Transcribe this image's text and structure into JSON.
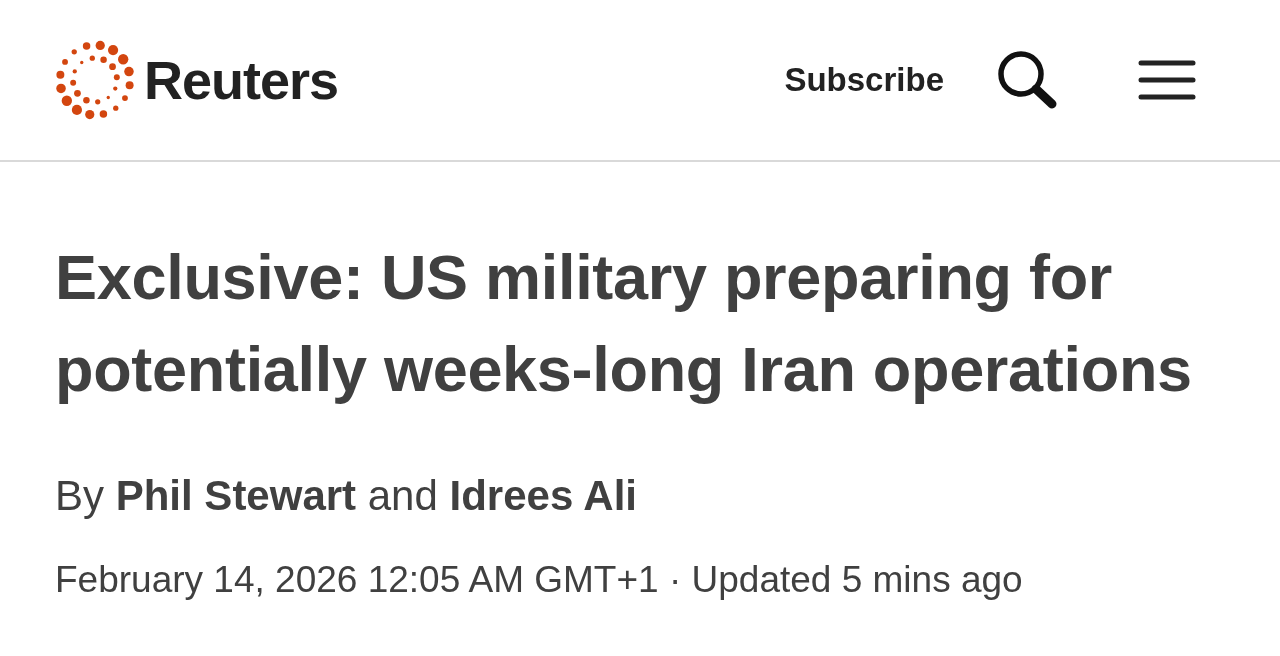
{
  "header": {
    "brand": "Reuters",
    "subscribe": "Subscribe"
  },
  "article": {
    "headline": "Exclusive: US military preparing for potentially weeks-long Iran operations",
    "byline": "By **Phil Stewart** and **Idrees Ali**",
    "dateline": "February 14, 2026 12:05 AM GMT+1 · Updated 5 mins ago"
  }
}
